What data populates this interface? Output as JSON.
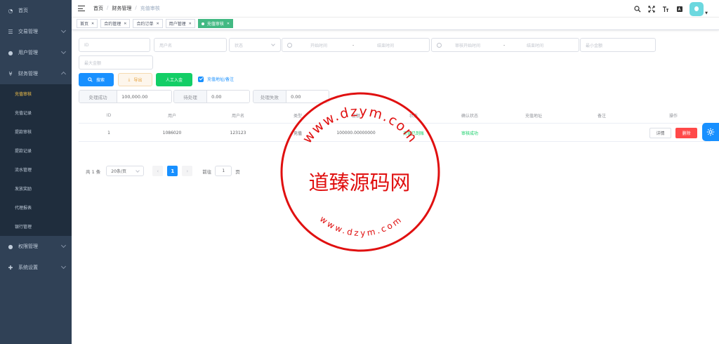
{
  "sidebar": {
    "items": [
      {
        "label": "首页",
        "icon": "dashboard-icon"
      },
      {
        "label": "交易管理",
        "icon": "list-icon"
      },
      {
        "label": "用户管理",
        "icon": "user-icon"
      },
      {
        "label": "财务管理",
        "icon": "yen-icon"
      }
    ],
    "finance_sub": [
      "充值审核",
      "充值记录",
      "提款审核",
      "提款记录",
      "流水管理",
      "发放奖励",
      "代理报表",
      "银行管理"
    ],
    "active_sub": "充值审核",
    "bottom_items": [
      {
        "label": "权限管理",
        "icon": "user-icon"
      },
      {
        "label": "系统设置",
        "icon": "plus-icon"
      }
    ]
  },
  "breadcrumb": [
    "首页",
    "财务管理",
    "充值审核"
  ],
  "tags": [
    {
      "label": "首页",
      "active": false
    },
    {
      "label": "合约管理",
      "active": false
    },
    {
      "label": "合约订单",
      "active": false
    },
    {
      "label": "用户管理",
      "active": false
    },
    {
      "label": "充值审核",
      "active": true
    }
  ],
  "filters": {
    "id_placeholder": "ID",
    "username_placeholder": "用户名",
    "status_placeholder": "状态",
    "start_time": "开始时间",
    "end_time": "结束时间",
    "range_sep": "-",
    "audit_start": "审核开始时间",
    "audit_end": "结束时间",
    "min_amount": "最小金额",
    "max_amount": "最大金额"
  },
  "actions": {
    "search": "搜索",
    "export": "导出",
    "manual_deposit": "人工入金",
    "show_address_label": "充值地址/备注"
  },
  "stats": [
    {
      "label": "处理成功",
      "value": "100,000.00"
    },
    {
      "label": "待处理",
      "value": "0.00"
    },
    {
      "label": "处理失败",
      "value": "0.00"
    }
  ],
  "table": {
    "headers": [
      "ID",
      "用户",
      "用户名",
      "类型",
      "金额",
      "状态",
      "确认状态",
      "充值地址",
      "备注",
      "操作"
    ],
    "rows": [
      {
        "id": "1",
        "user": "1086020",
        "username": "123123",
        "type": "充值",
        "amount": "100000.00000000",
        "status": "充值已到账",
        "confirm": "审核成功",
        "address": "",
        "remark": ""
      }
    ],
    "row_actions": {
      "detail": "详情",
      "delete": "删除"
    }
  },
  "pagination": {
    "total": "共 1 条",
    "page_size": "20条/页",
    "current": "1",
    "goto_label": "前往",
    "goto_value": "1",
    "page_suffix": "页"
  },
  "watermark": {
    "title": "道臻源码网",
    "ring_text": "www.dzym.com"
  },
  "colors": {
    "sidebar_bg": "#304156",
    "primary": "#1890ff",
    "success": "#13ce66",
    "danger": "#ff4949",
    "stamp": "#e01010"
  }
}
